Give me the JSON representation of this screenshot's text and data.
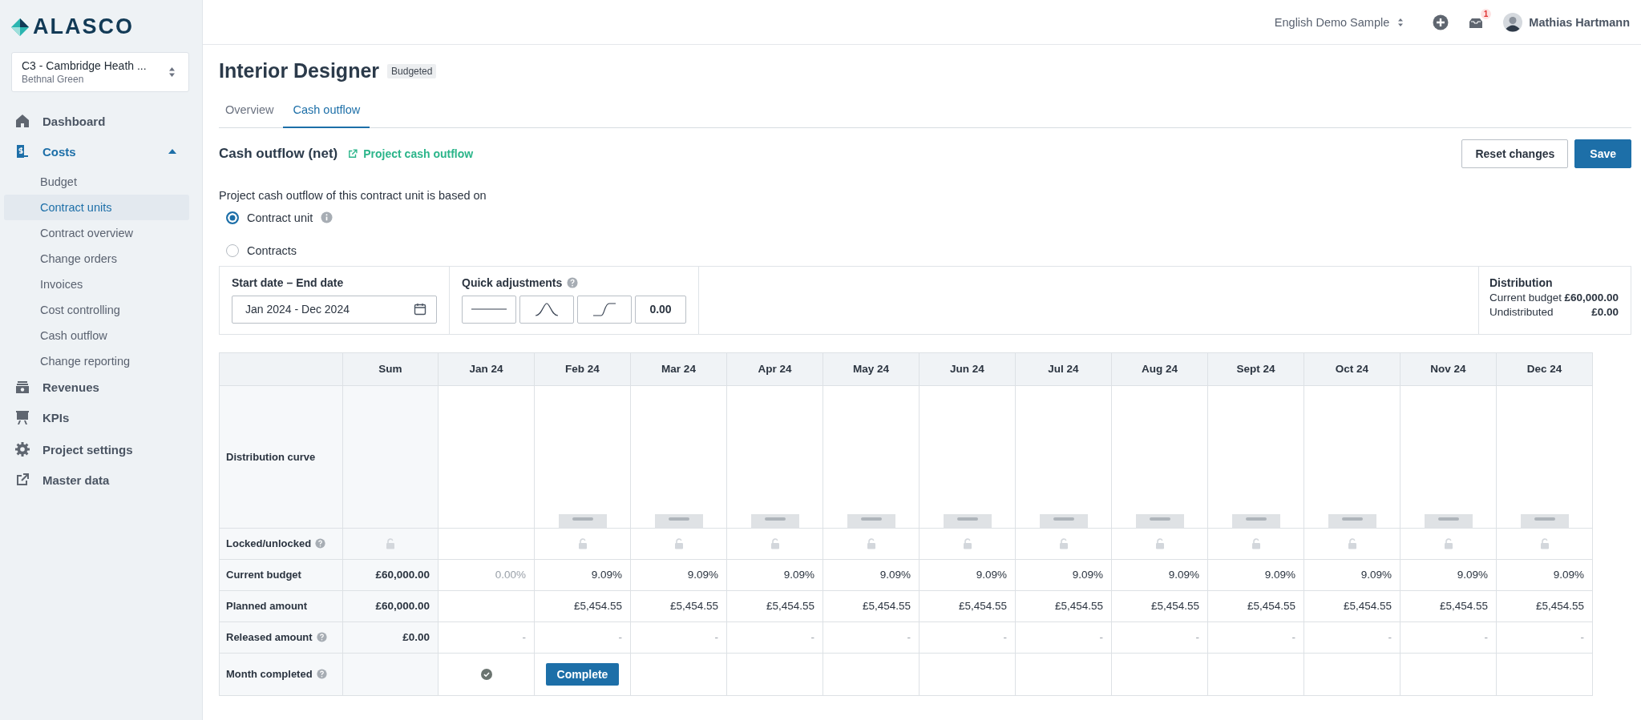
{
  "sidebar": {
    "logo": "ALASCO",
    "project": {
      "name": "C3 - Cambridge Heath ...",
      "location": "Bethnal Green"
    },
    "nav": [
      {
        "label": "Dashboard",
        "selected": false
      },
      {
        "label": "Costs",
        "selected": true,
        "expanded": true,
        "children": [
          {
            "label": "Budget",
            "selected": false
          },
          {
            "label": "Contract units",
            "selected": true
          },
          {
            "label": "Contract overview",
            "selected": false
          },
          {
            "label": "Change orders",
            "selected": false
          },
          {
            "label": "Invoices",
            "selected": false
          },
          {
            "label": "Cost controlling",
            "selected": false
          },
          {
            "label": "Cash outflow",
            "selected": false
          },
          {
            "label": "Change reporting",
            "selected": false
          }
        ]
      },
      {
        "label": "Revenues",
        "selected": false
      },
      {
        "label": "KPIs",
        "selected": false
      },
      {
        "label": "Project settings",
        "selected": false
      },
      {
        "label": "Master data",
        "selected": false
      }
    ]
  },
  "header": {
    "workspace": "English Demo Sample",
    "notifications": "1",
    "user": "Mathias Hartmann"
  },
  "page": {
    "title": "Interior Designer",
    "status": "Budgeted",
    "tabs": [
      {
        "label": "Overview",
        "selected": false
      },
      {
        "label": "Cash outflow",
        "selected": true
      }
    ],
    "section_title": "Cash outflow (net)",
    "section_link": "Project cash outflow",
    "buttons": [
      {
        "label": "Reset changes",
        "kind": "secondary"
      },
      {
        "label": "Save",
        "kind": "primary"
      }
    ],
    "basis_label": "Project cash outflow of this contract unit is based on",
    "basis_options": [
      {
        "label": "Contract unit",
        "selected": true,
        "info": true
      },
      {
        "label": "Contracts",
        "selected": false,
        "info": false
      }
    ],
    "date_range": {
      "label": "Start date – End date",
      "value": "Jan 2024 -  Dec 2024"
    },
    "quick_adjustments": {
      "label": "Quick adjustments",
      "value": "0.00"
    },
    "distribution": {
      "title": "Distribution",
      "rows": [
        {
          "label": "Current budget",
          "value": "£60,000.00"
        },
        {
          "label": "Undistributed",
          "value": "£0.00"
        }
      ]
    }
  },
  "table": {
    "sum_header": "Sum",
    "row_labels": [
      {
        "label": "Distribution curve",
        "help": false
      },
      {
        "label": "Locked/unlocked",
        "help": true
      },
      {
        "label": "Current budget",
        "help": false
      },
      {
        "label": "Planned amount",
        "help": false
      },
      {
        "label": "Released amount",
        "help": true
      },
      {
        "label": "Month completed",
        "help": true
      }
    ],
    "sum": {
      "locked": false,
      "budget": "£60,000.00",
      "planned": "£60,000.00",
      "released": "£0.00"
    },
    "months": [
      {
        "month": "Jan 24",
        "bar": false,
        "share": "0.00%",
        "share_muted": true,
        "released": "-",
        "completed": true
      },
      {
        "month": "Feb 24",
        "bar": true,
        "locked": false,
        "share": "9.09%",
        "share_muted": false,
        "planned": "£5,454.55",
        "released": "-",
        "completed": false,
        "action": "Complete"
      },
      {
        "month": "Mar 24",
        "bar": true,
        "locked": false,
        "share": "9.09%",
        "share_muted": false,
        "planned": "£5,454.55",
        "released": "-",
        "completed": false
      },
      {
        "month": "Apr 24",
        "bar": true,
        "locked": false,
        "share": "9.09%",
        "share_muted": false,
        "planned": "£5,454.55",
        "released": "-",
        "completed": false
      },
      {
        "month": "May 24",
        "bar": true,
        "locked": false,
        "share": "9.09%",
        "share_muted": false,
        "planned": "£5,454.55",
        "released": "-",
        "completed": false
      },
      {
        "month": "Jun 24",
        "bar": true,
        "locked": false,
        "share": "9.09%",
        "share_muted": false,
        "planned": "£5,454.55",
        "released": "-",
        "completed": false
      },
      {
        "month": "Jul 24",
        "bar": true,
        "locked": false,
        "share": "9.09%",
        "share_muted": false,
        "planned": "£5,454.55",
        "released": "-",
        "completed": false
      },
      {
        "month": "Aug 24",
        "bar": true,
        "locked": false,
        "share": "9.09%",
        "share_muted": false,
        "planned": "£5,454.55",
        "released": "-",
        "completed": false
      },
      {
        "month": "Sept 24",
        "bar": true,
        "locked": false,
        "share": "9.09%",
        "share_muted": false,
        "planned": "£5,454.55",
        "released": "-",
        "completed": false
      },
      {
        "month": "Oct 24",
        "bar": true,
        "locked": false,
        "share": "9.09%",
        "share_muted": false,
        "planned": "£5,454.55",
        "released": "-",
        "completed": false
      },
      {
        "month": "Nov 24",
        "bar": true,
        "locked": false,
        "share": "9.09%",
        "share_muted": false,
        "planned": "£5,454.55",
        "released": "-",
        "completed": false
      },
      {
        "month": "Dec 24",
        "bar": true,
        "locked": false,
        "share": "9.09%",
        "share_muted": false,
        "planned": "£5,454.55",
        "released": "-",
        "completed": false
      }
    ]
  }
}
